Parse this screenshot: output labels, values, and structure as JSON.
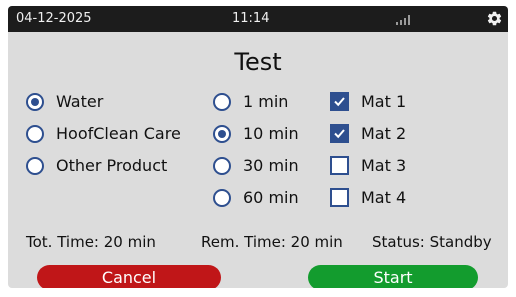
{
  "status_bar": {
    "date": "04-12-2025",
    "time": "11:14",
    "icons": [
      "signal-strength-icon",
      "gear-icon"
    ]
  },
  "title": "Test",
  "product_options": [
    {
      "label": "Water",
      "selected": true
    },
    {
      "label": "HoofClean Care",
      "selected": false
    },
    {
      "label": "Other Product",
      "selected": false
    }
  ],
  "time_options": [
    {
      "label": "1 min",
      "selected": false
    },
    {
      "label": "10 min",
      "selected": true
    },
    {
      "label": "30 min",
      "selected": false
    },
    {
      "label": "60 min",
      "selected": false
    }
  ],
  "mat_options": [
    {
      "label": "Mat 1",
      "checked": true
    },
    {
      "label": "Mat 2",
      "checked": true
    },
    {
      "label": "Mat 3",
      "checked": false
    },
    {
      "label": "Mat 4",
      "checked": false
    }
  ],
  "info": {
    "total_time": "Tot. Time: 20 min",
    "remaining_time": "Rem. Time: 20 min",
    "status": "Status: Standby"
  },
  "buttons": {
    "cancel": "Cancel",
    "start": "Start"
  },
  "colors": {
    "screen_bg": "#dcdcdc",
    "status_bar_bg": "#1c1c1c",
    "control_blue": "#2e4f8f",
    "cancel_red": "#c01618",
    "start_green": "#139c2e"
  }
}
